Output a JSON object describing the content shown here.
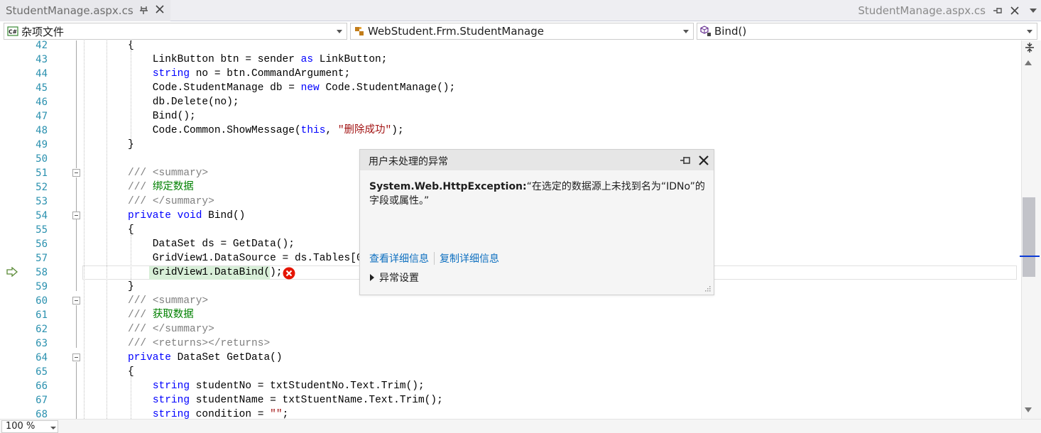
{
  "tab": {
    "title": "StudentManage.aspx.cs"
  },
  "right_title": "StudentManage.aspx.cs",
  "navbar": {
    "project": "杂项文件",
    "class": "WebStudent.Frm.StudentManage",
    "member": "Bind()"
  },
  "editor": {
    "lines": [
      {
        "num": "42",
        "html": "{"
      },
      {
        "num": "43",
        "html": "    LinkButton btn = sender <span class=\"kw\">as</span> LinkButton;"
      },
      {
        "num": "44",
        "html": "    <span class=\"kw\">string</span> no = btn.CommandArgument;"
      },
      {
        "num": "45",
        "html": "    Code.StudentManage db = <span class=\"kw\">new</span> Code.StudentManage();"
      },
      {
        "num": "46",
        "html": "    db.Delete(no);"
      },
      {
        "num": "47",
        "html": "    Bind();"
      },
      {
        "num": "48",
        "html": "    Code.Common.ShowMessage(<span class=\"kw\">this</span>, <span class=\"str\">\"删除成功\"</span>);"
      },
      {
        "num": "49",
        "html": "}"
      },
      {
        "num": "50",
        "html": ""
      },
      {
        "num": "51",
        "html": "<span class=\"cmt\">///</span> <span class=\"cmt\">&lt;summary&gt;</span>"
      },
      {
        "num": "52",
        "html": "<span class=\"cmt\">///</span> <span class=\"cm\">绑定数据</span>"
      },
      {
        "num": "53",
        "html": "<span class=\"cmt\">///</span> <span class=\"cmt\">&lt;/summary&gt;</span>"
      },
      {
        "num": "54",
        "html": "<span class=\"kw\">private</span> <span class=\"kw\">void</span> Bind()"
      },
      {
        "num": "55",
        "html": "{"
      },
      {
        "num": "56",
        "html": "    DataSet ds = GetData();"
      },
      {
        "num": "57",
        "html": "    GridView1.DataSource = ds.Tables[0];"
      },
      {
        "num": "58",
        "html": "    GridView1.DataBind();"
      },
      {
        "num": "59",
        "html": "}"
      },
      {
        "num": "60",
        "html": "<span class=\"cmt\">///</span> <span class=\"cmt\">&lt;summary&gt;</span>"
      },
      {
        "num": "61",
        "html": "<span class=\"cmt\">///</span> <span class=\"cm\">获取数据</span>"
      },
      {
        "num": "62",
        "html": "<span class=\"cmt\">///</span> <span class=\"cmt\">&lt;/summary&gt;</span>"
      },
      {
        "num": "63",
        "html": "<span class=\"cmt\">///</span> <span class=\"cmt\">&lt;returns&gt;&lt;/returns&gt;</span>"
      },
      {
        "num": "64",
        "html": "<span class=\"kw\">private</span> DataSet GetData()"
      },
      {
        "num": "65",
        "html": "{"
      },
      {
        "num": "66",
        "html": "    <span class=\"kw\">string</span> studentNo = txtStudentNo.Text.Trim();"
      },
      {
        "num": "67",
        "html": "    <span class=\"kw\">string</span> studentName = txtStuentName.Text.Trim();"
      },
      {
        "num": "68",
        "html": "    <span class=\"kw\">string</span> condition = <span class=\"str\">\"\"</span>;"
      }
    ]
  },
  "exception": {
    "title": "用户未处理的异常",
    "type": "System.Web.HttpException:",
    "message": "“在选定的数据源上未找到名为“IDNo”的字段或属性。”",
    "link_details": "查看详细信息",
    "link_copy": "复制详细信息",
    "settings": "异常设置"
  },
  "zoom": "100 %",
  "colors": {
    "keyword": "#0000ff",
    "comment": "#008000",
    "line_number": "#2b91af",
    "link": "#0e70c0",
    "error": "#e51400"
  }
}
